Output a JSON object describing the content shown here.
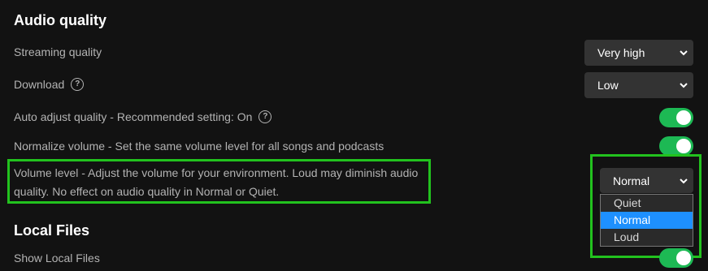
{
  "audio_quality": {
    "title": "Audio quality",
    "streaming": {
      "label": "Streaming quality",
      "value": "Very high"
    },
    "download": {
      "label": "Download",
      "value": "Low"
    },
    "auto_adjust": {
      "label": "Auto adjust quality - Recommended setting: On",
      "enabled": true
    },
    "normalize": {
      "label": "Normalize volume - Set the same volume level for all songs and podcasts",
      "enabled": true
    },
    "volume_level": {
      "label_line1": "Volume level - Adjust the volume for your environment. Loud may diminish audio",
      "label_line2": "quality. No effect on audio quality in Normal or Quiet.",
      "value": "Normal",
      "options": [
        "Quiet",
        "Normal",
        "Loud"
      ],
      "selected_option": "Normal"
    }
  },
  "local_files": {
    "title": "Local Files",
    "show_local": {
      "label": "Show Local Files",
      "enabled": true
    }
  },
  "colors": {
    "background": "#121212",
    "accent": "#1db954",
    "highlight_border": "#22c21e",
    "option_selected": "#1e90ff"
  },
  "icons": {
    "help": "question-circle-icon",
    "chevron": "chevron-down-icon"
  }
}
